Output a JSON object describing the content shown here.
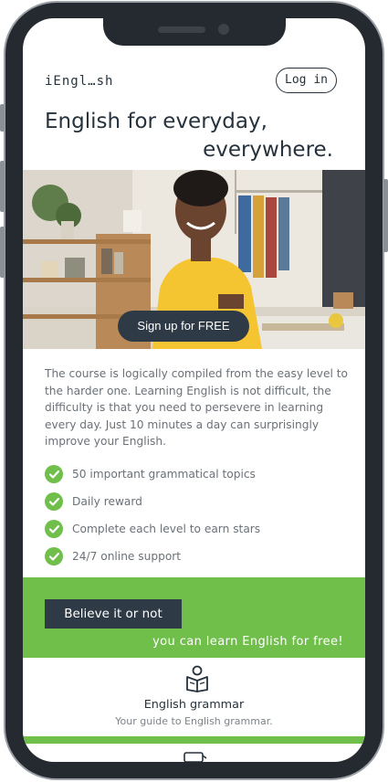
{
  "header": {
    "logo": "iEngl…sh",
    "login_label": "Log in"
  },
  "headline": {
    "line1": "English for everyday,",
    "line2": "everywhere."
  },
  "hero": {
    "signup_label": "Sign up for FREE"
  },
  "description": "The course is logically compiled from the easy level to the harder one. Learning English is not difficult, the difficulty is that you need to persevere in learning every day. Just 10 minutes a day can surprisingly improve your English.",
  "features": [
    "50 important grammatical topics",
    "Daily reward",
    "Complete each level to earn stars",
    "24/7 online support"
  ],
  "promo": {
    "believe": "Believe it or not",
    "free": "you can learn English for free!"
  },
  "grammar": {
    "title": "English grammar",
    "subtitle": "Your guide to English grammar."
  },
  "colors": {
    "accent_green": "#6fbf4a",
    "dark_navy": "#2f3a47",
    "text_dark": "#26323d"
  },
  "icons": [
    "check-icon",
    "book-reader-icon"
  ]
}
